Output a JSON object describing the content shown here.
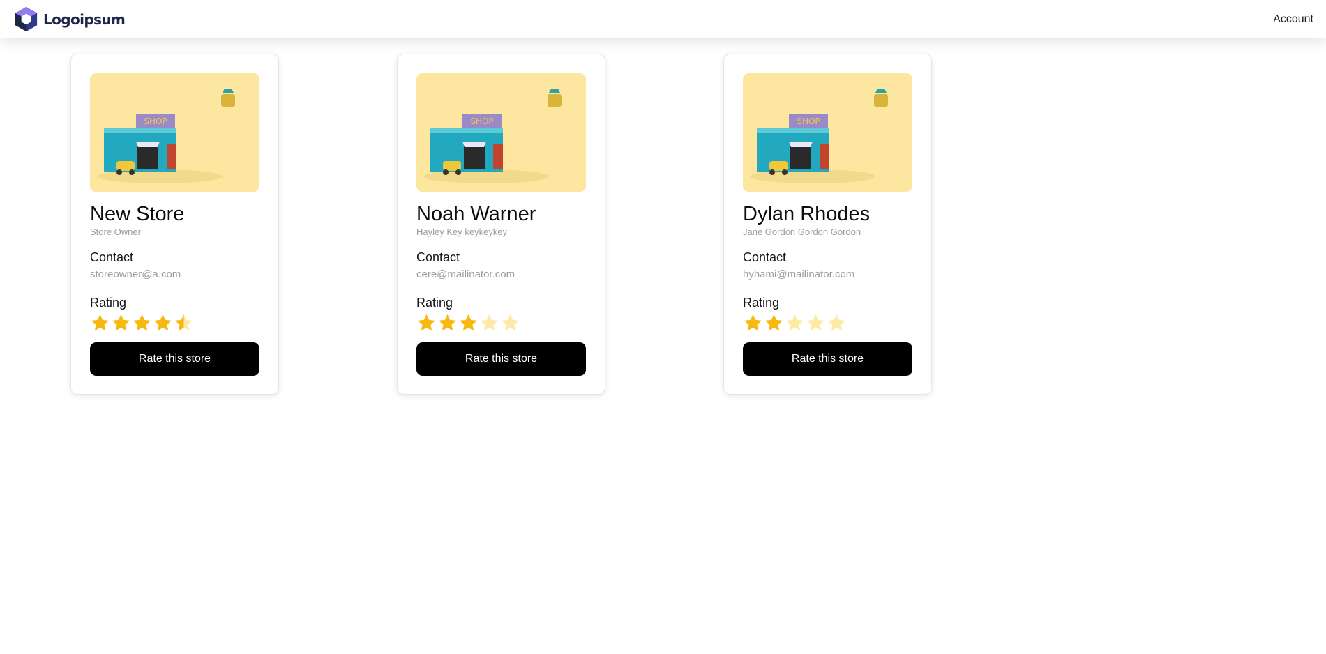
{
  "header": {
    "brand_name": "Logoipsum",
    "account_label": "Account"
  },
  "colors": {
    "star_filled": "#f7b90f",
    "star_empty": "#fdeaa6",
    "button_bg": "#000000",
    "image_bg": "#fde7a0"
  },
  "stores": [
    {
      "name": "New Store",
      "owner": "Store Owner",
      "contact_label": "Contact",
      "email": "storeowner@a.com",
      "rating_label": "Rating",
      "rating": 4.5,
      "rating_max": 5,
      "button_label": "Rate this store",
      "image_text": "SHOP"
    },
    {
      "name": "Noah Warner",
      "owner": "Hayley Key keykeykey",
      "contact_label": "Contact",
      "email": "cere@mailinator.com",
      "rating_label": "Rating",
      "rating": 3,
      "rating_max": 5,
      "button_label": "Rate this store",
      "image_text": "SHOP"
    },
    {
      "name": "Dylan Rhodes",
      "owner": "Jane Gordon Gordon Gordon",
      "contact_label": "Contact",
      "email": "hyhami@mailinator.com",
      "rating_label": "Rating",
      "rating": 2,
      "rating_max": 5,
      "button_label": "Rate this store",
      "image_text": "SHOP"
    }
  ]
}
